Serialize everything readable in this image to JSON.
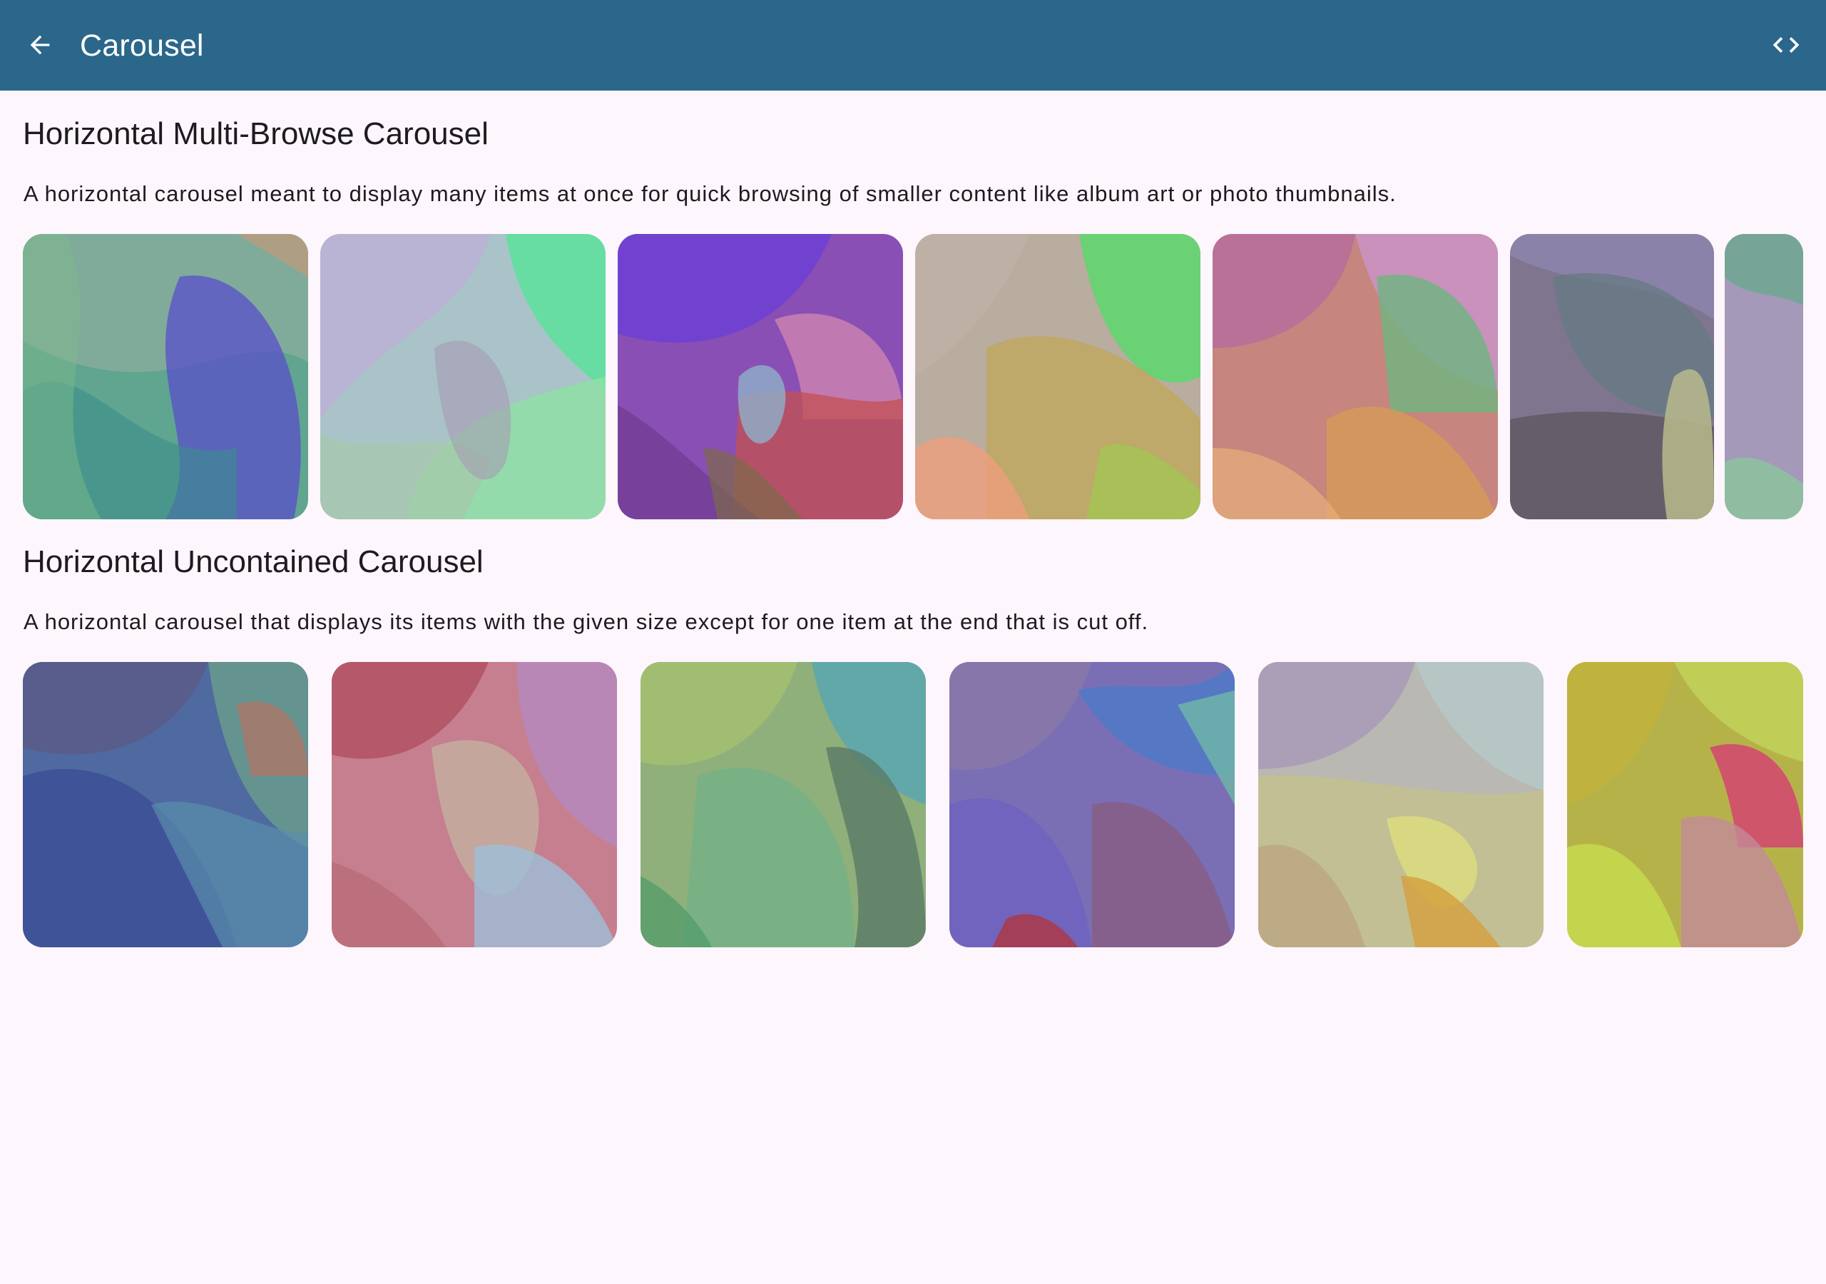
{
  "app_bar": {
    "title": "Carousel",
    "back_icon": "arrow-back-icon",
    "code_icon": "code-icon",
    "color": "#2b678b"
  },
  "sections": [
    {
      "title": "Horizontal Multi-Browse Carousel",
      "description": "A horizontal carousel meant to display many items at once for quick browsing of smaller content like album art or photo thumbnails."
    },
    {
      "title": "Horizontal Uncontained Carousel",
      "description": "A horizontal carousel that displays its items with the given size except for one item at the end that is cut off."
    }
  ]
}
